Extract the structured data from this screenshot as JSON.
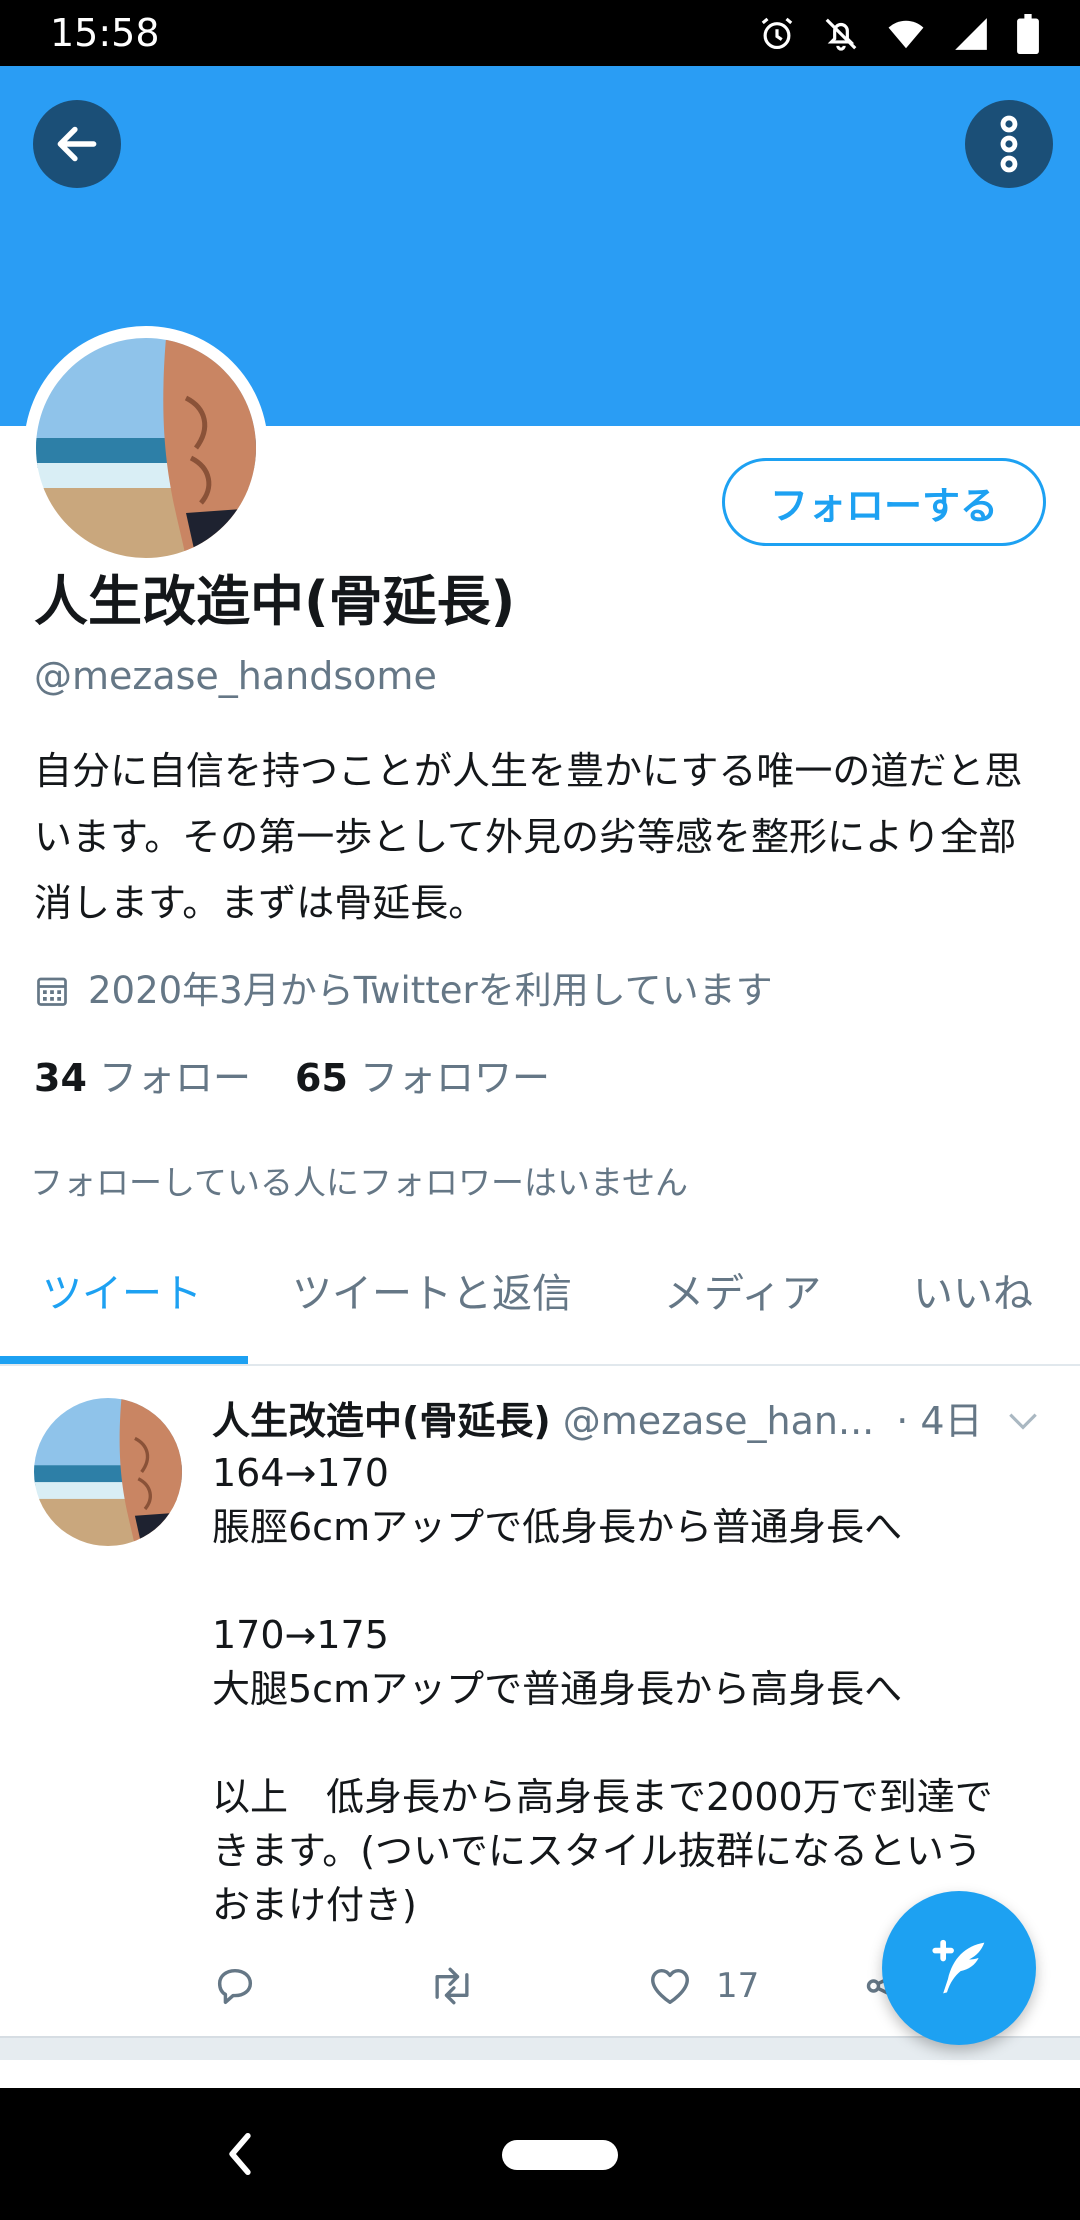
{
  "status_bar": {
    "time": "15:58"
  },
  "profile": {
    "follow_label": "フォローする",
    "display_name": "人生改造中(骨延長)",
    "handle": "@mezase_handsome",
    "bio": "自分に自信を持つことが人生を豊かにする唯一の道だと思います。その第一歩として外見の劣等感を整形により全部消します。まずは骨延長。",
    "joined": "2020年3月からTwitterを利用しています",
    "following_count": "34",
    "following_label": "フォロー",
    "followers_count": "65",
    "followers_label": "フォロワー",
    "no_common_followers": "フォローしている人にフォロワーはいません"
  },
  "tabs": [
    {
      "label": "ツイート",
      "active": true
    },
    {
      "label": "ツイートと返信",
      "active": false
    },
    {
      "label": "メディア",
      "active": false
    },
    {
      "label": "いいね",
      "active": false
    }
  ],
  "tweet": {
    "name": "人生改造中(骨延長)",
    "handle": "@mezase_han...",
    "time": "· 4日",
    "lines": [
      "164→170",
      "脹脛6cmアップで低身長から普通身長へ",
      "",
      "170→175",
      "大腿5cmアップで普通身長から高身長へ",
      "",
      "以上　低身長から高身長まで2000万で到達で",
      "きます。(ついでにスタイル抜群になるという",
      "おまけ付き)"
    ],
    "like_count": "17"
  },
  "colors": {
    "banner": "#2a9df4",
    "accent": "#1da1f2",
    "secondary_text": "#657786"
  },
  "icons": {
    "back": "arrow-left-icon",
    "menu": "more-vertical-icon",
    "calendar": "calendar-icon",
    "reply": "reply-icon",
    "retweet": "retweet-icon",
    "like": "heart-icon",
    "share": "share-icon",
    "compose": "compose-tweet-icon"
  }
}
